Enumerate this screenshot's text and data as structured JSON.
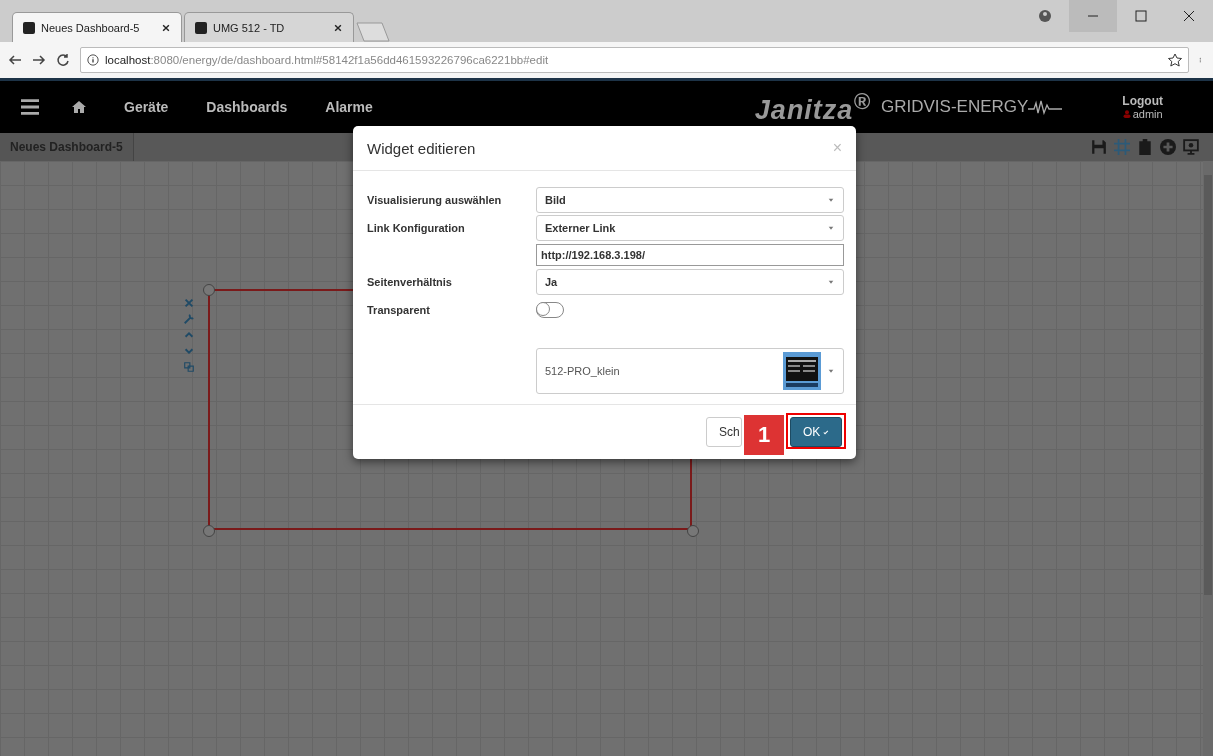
{
  "browser": {
    "tabs": [
      {
        "label": "Neues Dashboard-5",
        "selected": true
      },
      {
        "label": "UMG 512 - TD",
        "selected": false
      }
    ],
    "url_host": "localhost",
    "url_rest": ":8080/energy/de/dashboard.html#58142f1a56dd461593226796ca6221bb#edit"
  },
  "nav": {
    "items": [
      "Geräte",
      "Dashboards",
      "Alarme"
    ],
    "brand": "Janitza$^{®}$",
    "product": "GRIDVIS-ENERGY",
    "logout": "Logout",
    "user": "admin"
  },
  "dashboard_tab": "Neues Dashboard-5",
  "dialog": {
    "title": "Widget editieren",
    "close": "×",
    "fields": [
      {
        "kind": "select",
        "label": "Visualisierung auswählen",
        "value": "Bild"
      },
      {
        "kind": "select",
        "label": "Link Konfiguration",
        "value": "Externer Link"
      },
      {
        "kind": "input",
        "value": "http://192.168.3.198/"
      },
      {
        "kind": "select",
        "label": "Seitenverhältnis",
        "value": "Ja"
      },
      {
        "kind": "toggle",
        "label": "Transparent",
        "on": false
      },
      {
        "kind": "image-select",
        "value": "512-PRO_klein"
      }
    ],
    "buttons": [
      {
        "label": "Sch",
        "kind": "default"
      },
      {
        "label": "OK",
        "kind": "primary"
      }
    ]
  },
  "step_marker": "1"
}
